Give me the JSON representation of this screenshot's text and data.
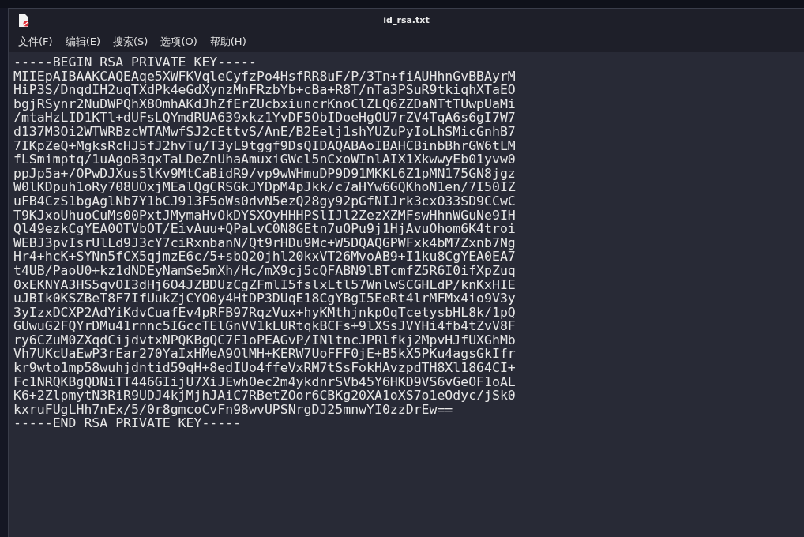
{
  "window": {
    "title": "id_rsa.txt"
  },
  "menu": [
    {
      "label": "文件(F)"
    },
    {
      "label": "编辑(E)"
    },
    {
      "label": "搜索(S)"
    },
    {
      "label": "选项(O)"
    },
    {
      "label": "帮助(H)"
    }
  ],
  "editor": {
    "lines": [
      "-----BEGIN RSA PRIVATE KEY-----",
      "MIIEpAIBAAKCAQEAqe5XWFKVqleCyfzPo4HsfRR8uF/P/3Tn+fiAUHhnGvBBAyrM",
      "HiP3S/DnqdIH2uqTXdPk4eGdXynzMnFRzbYb+cBa+R8T/nTa3PSuR9tkiqhXTaEO",
      "bgjRSynr2NuDWPQhX8OmhAKdJhZfErZUcbxiuncrKnoClZLQ6ZZDaNTtTUwpUaMi",
      "/mtaHzLID1KTl+dUFsLQYmdRUA639xkz1YvDF5ObIDoeHgOU7rZV4TqA6s6gI7W7",
      "d137M3Oi2WTWRBzcWTAMwfSJ2cEttvS/AnE/B2Eelj1shYUZuPyIoLhSMicGnhB7",
      "7IKpZeQ+MgksRcHJ5fJ2hvTu/T3yL9tggf9DsQIDAQABAoIBAHCBinbBhrGW6tLM",
      "fLSmimptq/1uAgoB3qxTaLDeZnUhaAmuxiGWcl5nCxoWInlAIX1XkwwyEb01yvw0",
      "ppJp5a+/OPwDJXus5lKv9MtCaBidR9/vp9wWHmuDP9D91MKKL6Z1pMN175GN8jgz",
      "W0lKDpuh1oRy708UOxjMEalQgCRSGkJYDpM4pJkk/c7aHYw6GQKhoN1en/7I50IZ",
      "uFB4CzS1bgAglNb7Y1bCJ913F5oWs0dvN5ezQ28gy92pGfNIJrk3cxO33SD9CCwC",
      "T9KJxoUhuoCuMs00PxtJMymaHvOkDYSXOyHHHPSlIJl2ZezXZMFswHhnWGuNe9IH",
      "Ql49ezkCgYEA0OTVbOT/EivAuu+QPaLvC0N8GEtn7uOPu9j1HjAvuOhom6K4troi",
      "WEBJ3pvIsrUlLd9J3cY7ciRxnbanN/Qt9rHDu9Mc+W5DQAQGPWFxk4bM7Zxnb7Ng",
      "Hr4+hcK+SYNn5fCX5qjmzE6c/5+sbQ20jhl20kxVT26MvoAB9+I1ku8CgYEA0EA7",
      "t4UB/PaoU0+kz1dNDEyNamSe5mXh/Hc/mX9cj5cQFABN9lBTcmfZ5R6I0ifXpZuq",
      "0xEKNYA3HS5qvOI3dHj6O4JZBDUzCgZFmlI5fslxLtl57WnlwSCGHLdP/knKxHIE",
      "uJBIk0KSZBeT8F7IfUukZjCYO0y4HtDP3DUqE18CgYBgI5EeRt4lrMFMx4io9V3y",
      "3yIzxDCXP2AdYiKdvCuafEv4pRFB97RqzVux+hyKMthjnkpOqTcetysbHL8k/1pQ",
      "GUwuG2FQYrDMu41rnnc5IGccTElGnVV1kLURtqkBCFs+9lXSsJVYHi4fb4tZvV8F",
      "ry6CZuM0ZXqdCijdvtxNPQKBgQC7F1oPEAGvP/INltncJPRlfkj2MpvHJfUXGhMb",
      "Vh7UKcUaEwP3rEar270YaIxHMeA9OlMH+KERW7UoFFF0jE+B5kX5PKu4agsGkIfr",
      "kr9wto1mp58wuhjdntid59qH+8edIUo4ffeVxRM7tSsFokHAvzpdTH8Xl1864CI+",
      "Fc1NRQKBgQDNiTT446GIijU7XiJEwhOec2m4ykdnrSVb45Y6HKD9VS6vGeOF1oAL",
      "K6+2ZlpmytN3RiR9UDJ4kjMjhJAiC7RBetZOor6CBKg20XA1oXS7o1eOdyc/jSk0",
      "kxruFUgLHh7nEx/5/0r8gmcoCvFn98wvUPSNrgDJ25mnwYI0zzDrEw==",
      "-----END RSA PRIVATE KEY-----"
    ]
  }
}
